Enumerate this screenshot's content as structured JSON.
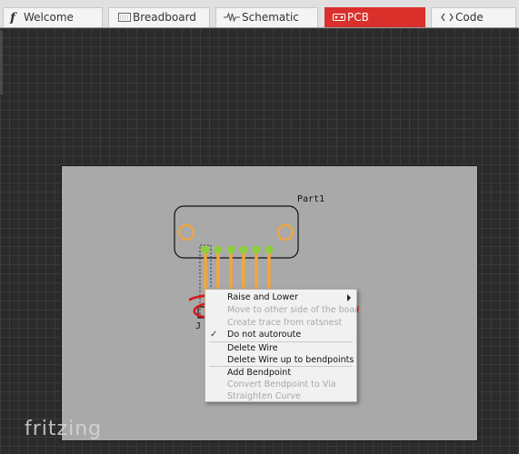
{
  "tabs": [
    {
      "label": "Welcome",
      "icon": "fritzing-f-icon"
    },
    {
      "label": "Breadboard",
      "icon": "breadboard-icon"
    },
    {
      "label": "Schematic",
      "icon": "schematic-icon"
    },
    {
      "label": "PCB",
      "icon": "pcb-icon",
      "active": true
    },
    {
      "label": "Code",
      "icon": "code-icon"
    }
  ],
  "canvas": {
    "part_label": "Part1",
    "connector_label": "J",
    "logo_text": "fritzing",
    "board_color": "#a9a9a9",
    "trace_color": "#f4a53a",
    "pad_color": "#8dcf3a",
    "annotation_color": "#d9161b"
  },
  "context_menu": {
    "items": [
      {
        "label": "Raise and Lower",
        "enabled": true,
        "submenu": true
      },
      {
        "label": "Move to other side of the board",
        "enabled": false
      },
      {
        "label": "Create trace from ratsnest",
        "enabled": false
      },
      {
        "label": "Do not autoroute",
        "enabled": true,
        "checked": true
      },
      {
        "label": "Delete Wire",
        "enabled": true
      },
      {
        "label": "Delete Wire up to bendpoints",
        "enabled": true
      },
      {
        "label": "Add Bendpoint",
        "enabled": true
      },
      {
        "label": "Convert Bendpoint to Via",
        "enabled": false
      },
      {
        "label": "Straighten Curve",
        "enabled": false
      }
    ]
  },
  "accent_color": "#d9302b"
}
